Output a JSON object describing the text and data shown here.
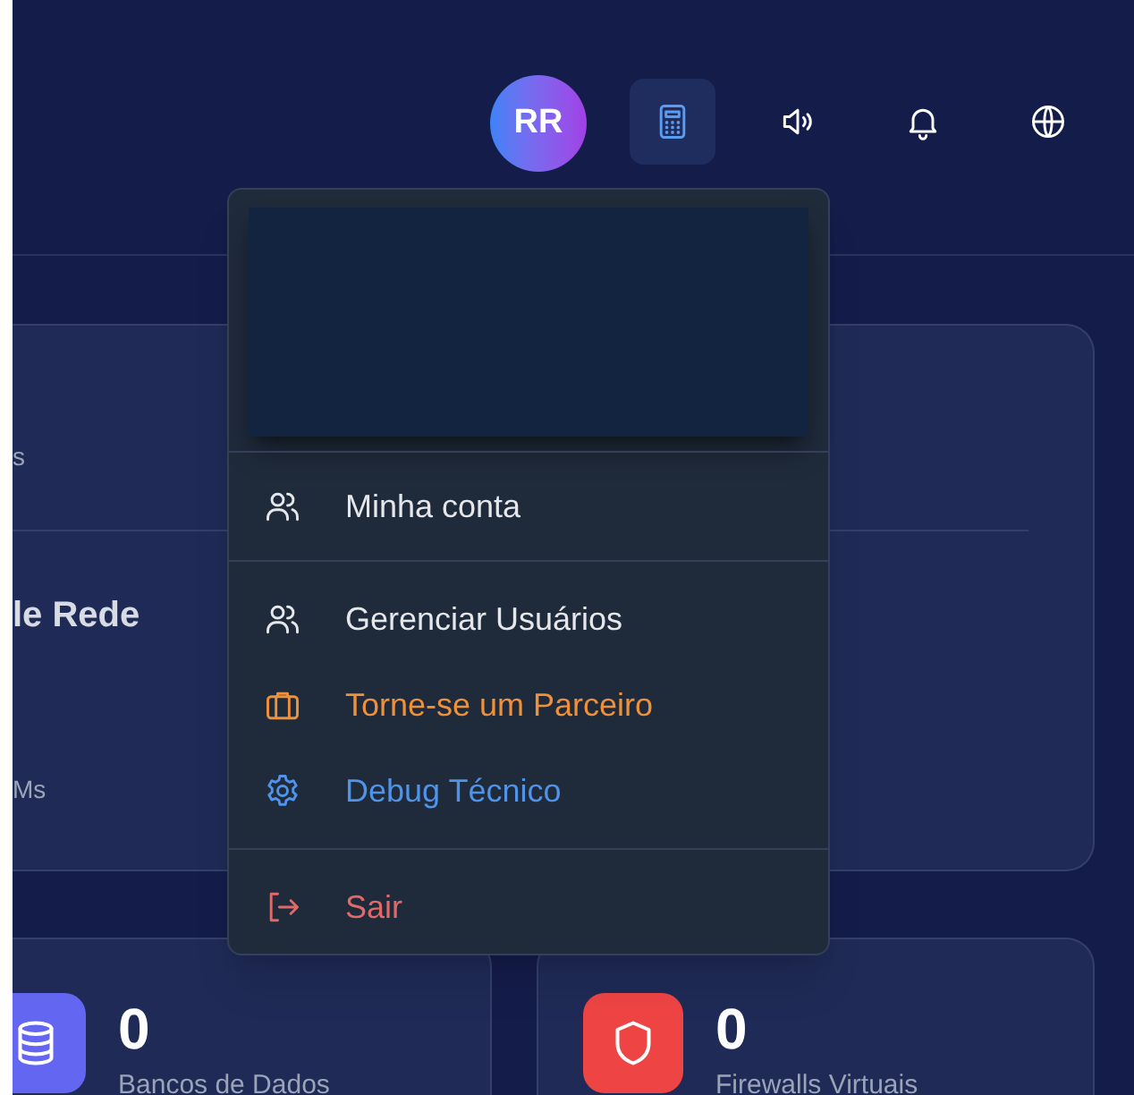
{
  "header": {
    "avatar": {
      "initials": "RR"
    },
    "actions": [
      {
        "kind": "calculator",
        "selected": true
      },
      {
        "kind": "speaker",
        "selected": false
      },
      {
        "kind": "bell",
        "selected": false
      },
      {
        "kind": "globe",
        "selected": false
      }
    ]
  },
  "user_menu": {
    "groups": [
      [
        {
          "label": "Minha conta",
          "kind": "users",
          "color": "#e5e7eb"
        }
      ],
      [
        {
          "label": "Gerenciar Usuários",
          "kind": "users",
          "color": "#e5e7eb"
        },
        {
          "label": "Torne-se um Parceiro",
          "kind": "briefcase",
          "color": "#f0913a"
        },
        {
          "label": "Debug Técnico",
          "kind": "gear",
          "color": "#4f94e8"
        }
      ],
      [
        {
          "label": "Sair",
          "kind": "logout",
          "color": "#e06a6a"
        }
      ]
    ]
  },
  "overview_card": {
    "texts": [
      "s",
      "le Rede",
      "Ms"
    ]
  },
  "stats": [
    {
      "kind": "database",
      "color": "#6366f1",
      "value": "0",
      "label": "Bancos de Dados"
    },
    {
      "kind": "shield",
      "color": "#ef4444",
      "value": "0",
      "label": "Firewalls Virtuais"
    }
  ]
}
